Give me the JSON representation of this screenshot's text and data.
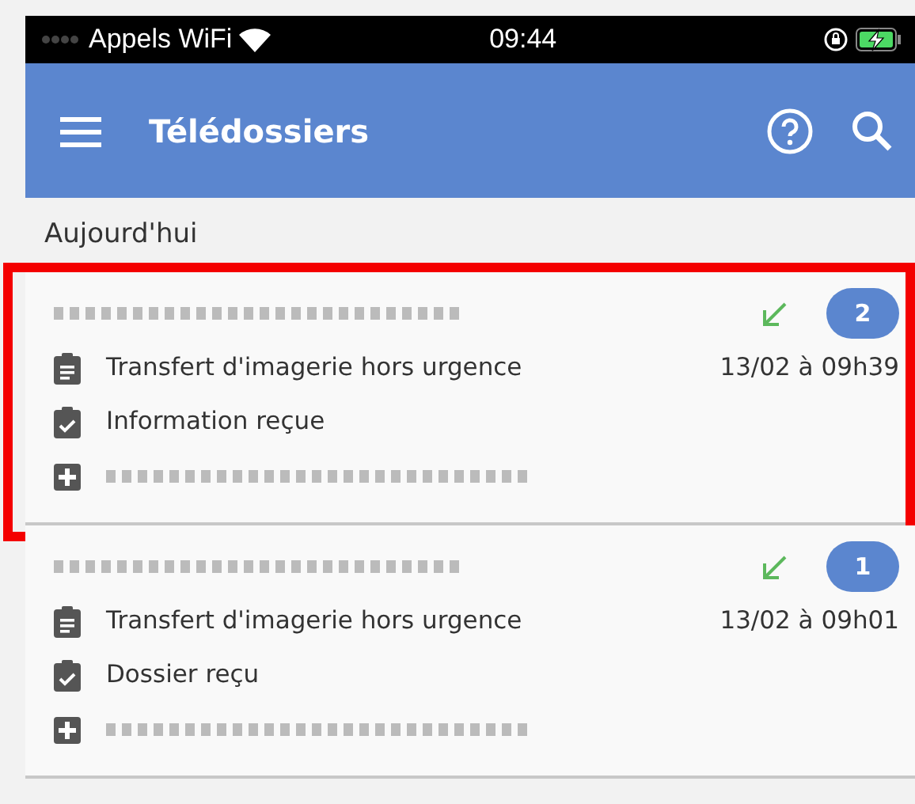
{
  "status_bar": {
    "carrier": "Appels WiFi",
    "time": "09:44"
  },
  "app_bar": {
    "title": "Télédossiers"
  },
  "section": {
    "title": "Aujourd'hui"
  },
  "items": [
    {
      "highlighted": true,
      "count": "2",
      "incoming": true,
      "type": "Transfert d'imagerie hors urgence",
      "date": "13/02 à 09h39",
      "status": "Information reçue"
    },
    {
      "highlighted": false,
      "count": "1",
      "incoming": true,
      "type": "Transfert d'imagerie hors urgence",
      "date": "13/02 à 09h01",
      "status": "Dossier reçu"
    }
  ]
}
